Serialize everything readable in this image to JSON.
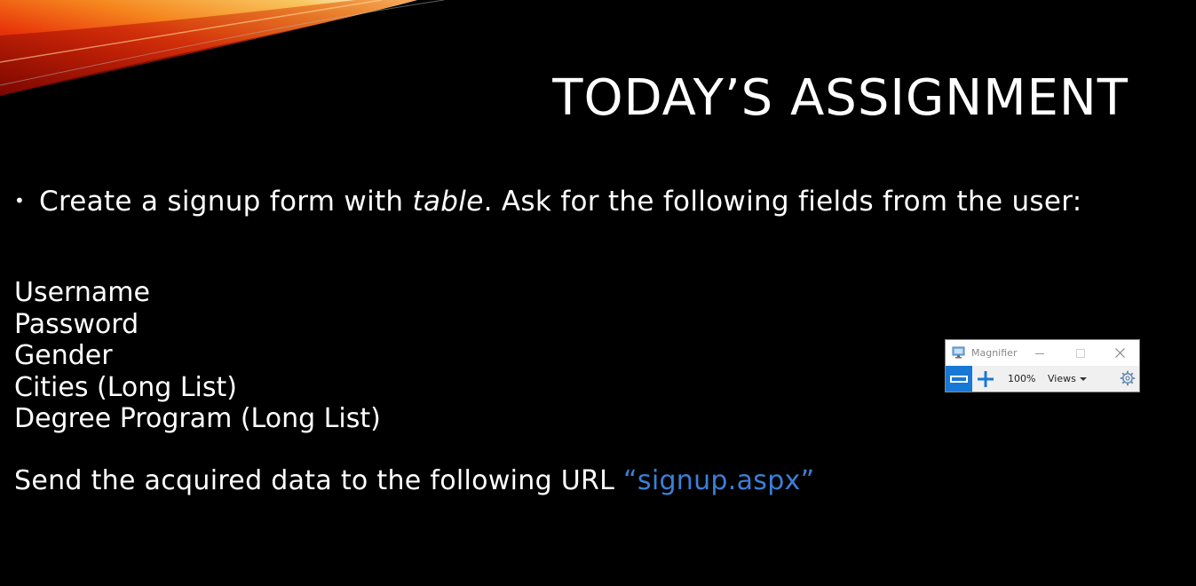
{
  "slide": {
    "title": "TODAY’S ASSIGNMENT",
    "bullet": {
      "before": "Create a signup form with ",
      "emphasis": "table",
      "after": ". Ask for the following fields from the user:"
    },
    "fields": [
      "Username",
      "Password",
      "Gender",
      "Cities (Long List)",
      "Degree Program (Long List)"
    ],
    "send": {
      "text": "Send the acquired data to the following URL  ",
      "url": "“signup.aspx”"
    }
  },
  "magnifier": {
    "title": "Magnifier",
    "zoom_level": "100%",
    "views_label": "Views",
    "icons": {
      "app": "magnifier-app-icon",
      "zoom_out": "zoom-out-icon",
      "zoom_in": "zoom-in-icon",
      "settings": "gear-icon"
    },
    "accent_color": "#1778d6"
  },
  "colors": {
    "background": "#000000",
    "text": "#ffffff",
    "url": "#3c7fd8"
  }
}
